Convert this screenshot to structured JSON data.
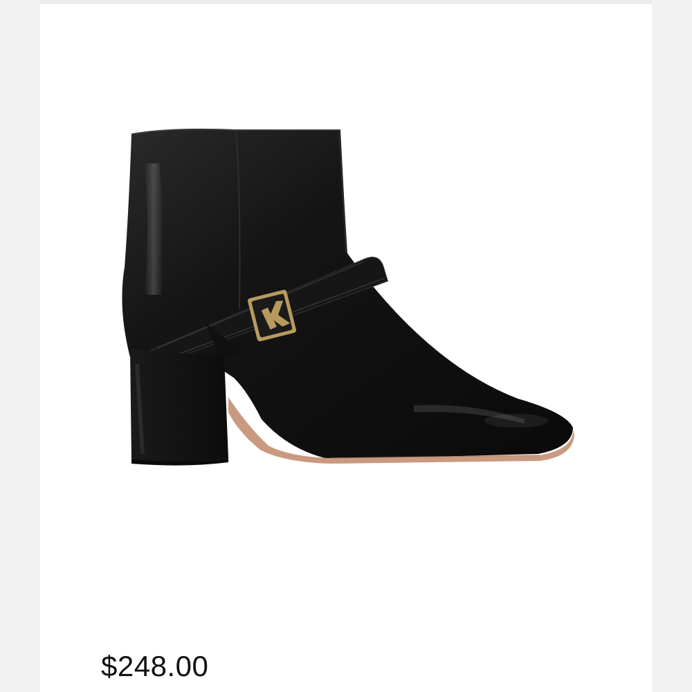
{
  "listing": {
    "price": "$248.00"
  },
  "product_image": {
    "icon": "ankle-boot-image",
    "hardware_icon": "k-monogram-buckle-icon"
  },
  "colors": {
    "background": "#ffffff",
    "side_strip": "#f2f2f2",
    "boot_leather": "#111111",
    "sole": "#c99a80",
    "buckle_gold": "#b79a5e",
    "price_text": "#111111"
  }
}
